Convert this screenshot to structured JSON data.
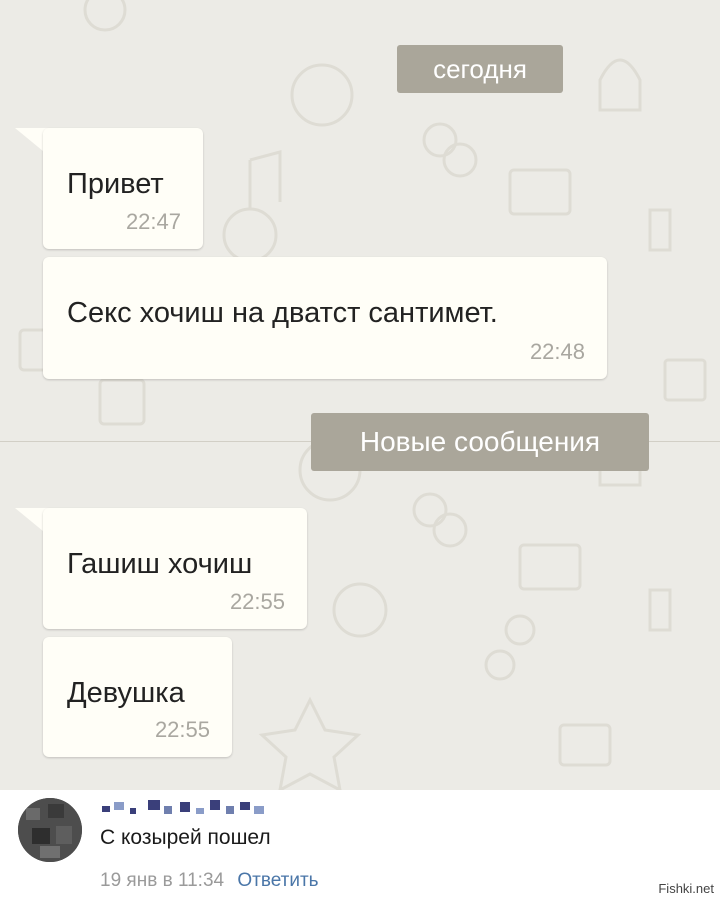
{
  "chat": {
    "date_label": "сегодня",
    "new_messages_label": "Новые сообщения",
    "messages": [
      {
        "text": "Привет",
        "time": "22:47"
      },
      {
        "text": "Секс хочиш на дватст сантимет.",
        "time": "22:48"
      },
      {
        "text": "Гашиш хочиш",
        "time": "22:55"
      },
      {
        "text": "Девушка",
        "time": "22:55"
      }
    ]
  },
  "comment": {
    "text": "С козырей пошел",
    "date": "19 янв в 11:34",
    "reply_label": "Ответить"
  },
  "watermark": "Fishki.net",
  "colors": {
    "chat_background": "#ecebe6",
    "bubble": "#fffef7",
    "pill": "#aaa69a",
    "link": "#4a76a8"
  }
}
